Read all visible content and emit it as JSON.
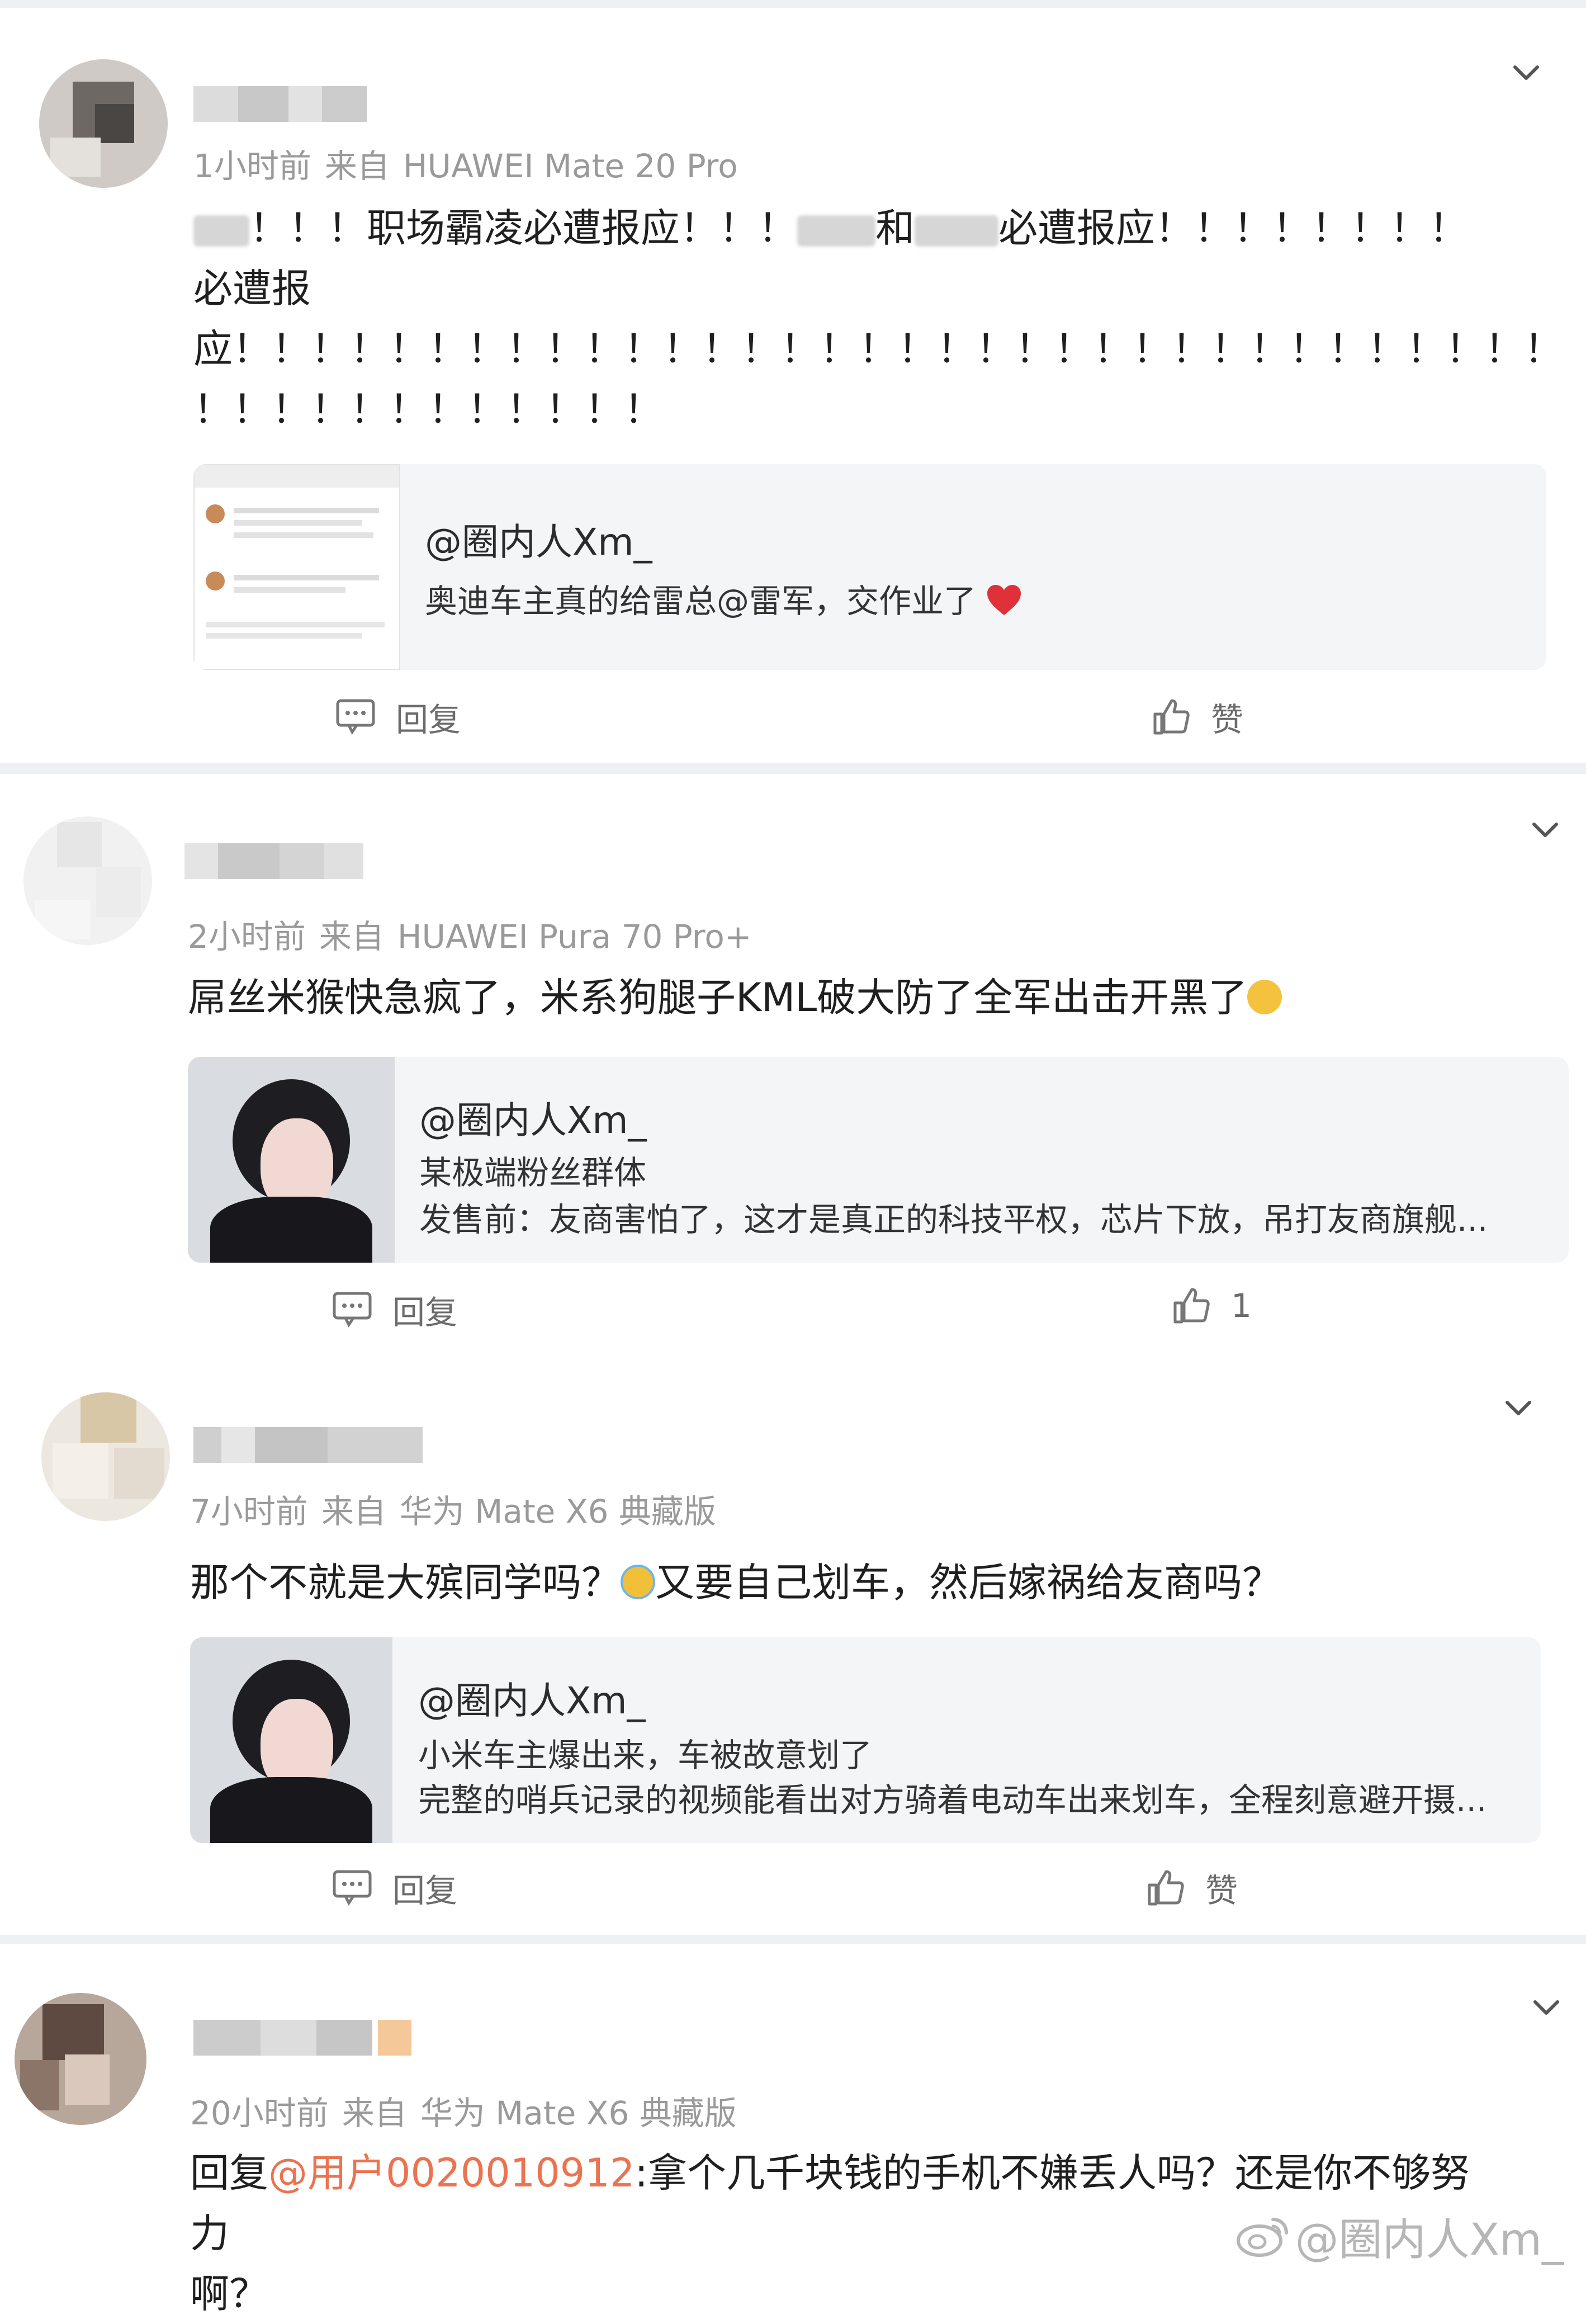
{
  "comments": [
    {
      "meta": {
        "time": "1小时前",
        "from_label": "来自",
        "device": "HUAWEI Mate 20 Pro"
      },
      "text": {
        "part1": "！！！职场霸凌必遭报应！！！",
        "part2": "和",
        "part3": "必遭报应！！！！！！！！",
        "line2": "必遭报",
        "line3": "应！！！！！！！！！！！！！！！！！！！！！！！！！！！！！！！！！！",
        "line4": "！！！！！！！！！！！！"
      },
      "quote": {
        "author": "@圈内人Xm_",
        "line1": "奥迪车主真的给雷总@雷军，交作业了"
      },
      "actions": {
        "reply": "回复",
        "like": "赞"
      }
    },
    {
      "meta": {
        "time": "2小时前",
        "from_label": "来自",
        "device": "HUAWEI Pura 70 Pro+"
      },
      "text": {
        "line1": "屌丝米猴快急疯了，米系狗腿子KML破大防了全军出击开黑了"
      },
      "quote": {
        "author": "@圈内人Xm_",
        "line1": "某极端粉丝群体",
        "line2": "发售前：友商害怕了，这才是真正的科技平权，芯片下放，吊打友商旗舰..."
      },
      "actions": {
        "reply": "回复",
        "like": "1"
      }
    },
    {
      "meta": {
        "time": "7小时前",
        "from_label": "来自",
        "device": "华为 Mate X6 典藏版"
      },
      "text": {
        "part1": "那个不就是大殡同学吗？",
        "part2": "又要自己划车，然后嫁祸给友商吗？"
      },
      "quote": {
        "author": "@圈内人Xm_",
        "line1": "小米车主爆出来，车被故意划了",
        "line2": "完整的哨兵记录的视频能看出对方骑着电动车出来划车，全程刻意避开摄..."
      },
      "actions": {
        "reply": "回复",
        "like": "赞"
      }
    },
    {
      "meta": {
        "time": "20小时前",
        "from_label": "来自",
        "device": "华为 Mate X6 典藏版"
      },
      "text": {
        "reply_prefix": "回复",
        "mention": "@用户0020010912",
        "rest": ":拿个几千块钱的手机不嫌丢人吗？还是你不够努力",
        "line2": "啊？"
      }
    }
  ],
  "watermark": "@圈内人Xm_",
  "colors": {
    "mention": "#eb7350",
    "separator": "#eef0f4",
    "quote_bg": "#f4f5f7",
    "meta": "#9a9a9a"
  },
  "icons": [
    "chevron-down-icon",
    "comment-icon",
    "thumbs-up-icon",
    "heart-icon",
    "weibo-logo-icon"
  ]
}
